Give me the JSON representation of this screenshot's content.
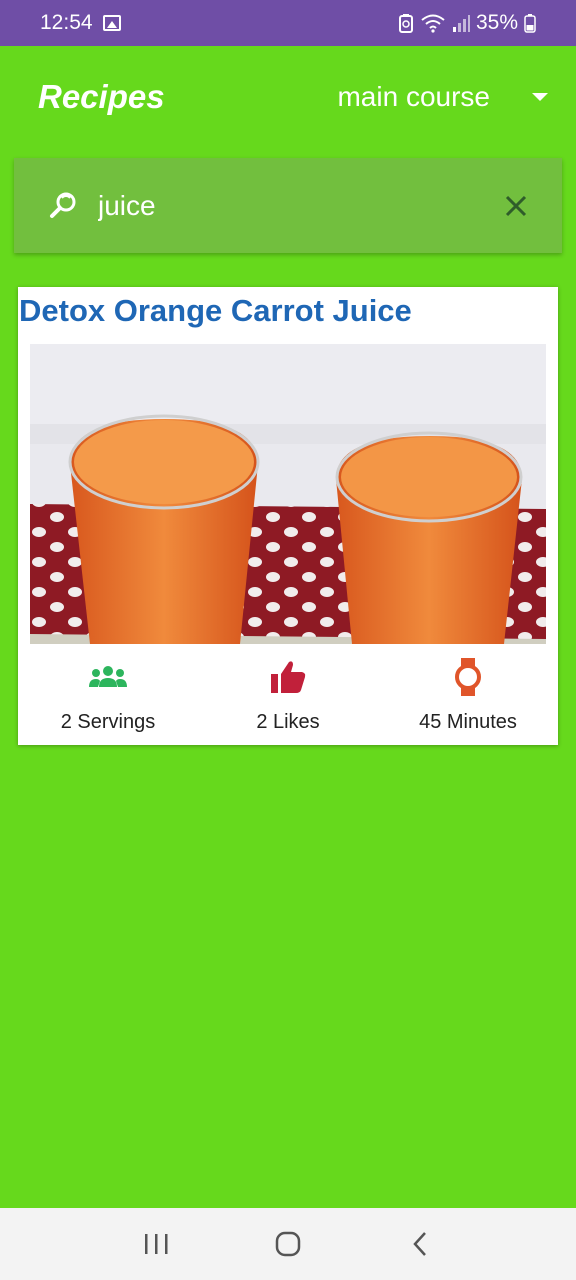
{
  "status": {
    "time": "12:54",
    "battery": "35%"
  },
  "app_bar": {
    "title": "Recipes",
    "category": "main course"
  },
  "search": {
    "value": "juice"
  },
  "recipe": {
    "title": "Detox Orange Carrot Juice",
    "servings": "2 Servings",
    "likes": "2 Likes",
    "time": "45 Minutes"
  },
  "colors": {
    "status_bar": "#6f4ea6",
    "background": "#66d91c",
    "search_bg": "#72bf3e",
    "title_blue": "#1f67b5",
    "servings_icon": "#2db55d",
    "likes_icon": "#c1203a",
    "time_icon": "#e0552a"
  },
  "icons": {
    "search": "search-icon",
    "clear": "close-icon",
    "servings": "group-icon",
    "likes": "thumb-up-icon",
    "time": "watch-icon"
  }
}
